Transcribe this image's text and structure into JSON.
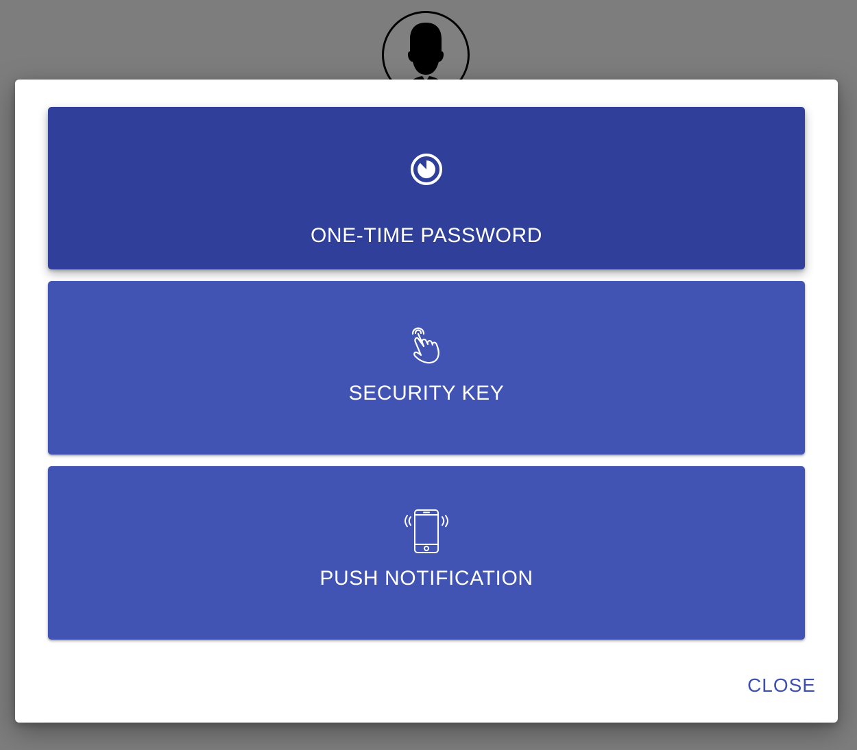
{
  "dialog": {
    "methods": [
      {
        "label": "ONE-TIME PASSWORD",
        "icon": "timer-icon",
        "selected": true
      },
      {
        "label": "SECURITY KEY",
        "icon": "touch-finger-icon",
        "selected": false
      },
      {
        "label": "PUSH NOTIFICATION",
        "icon": "phone-vibrate-icon",
        "selected": false
      }
    ],
    "close_label": "CLOSE"
  },
  "colors": {
    "backdrop": "#7d7d7d",
    "button": "#4154b4",
    "button_selected": "#30409a",
    "close_text": "#3e4fae"
  }
}
